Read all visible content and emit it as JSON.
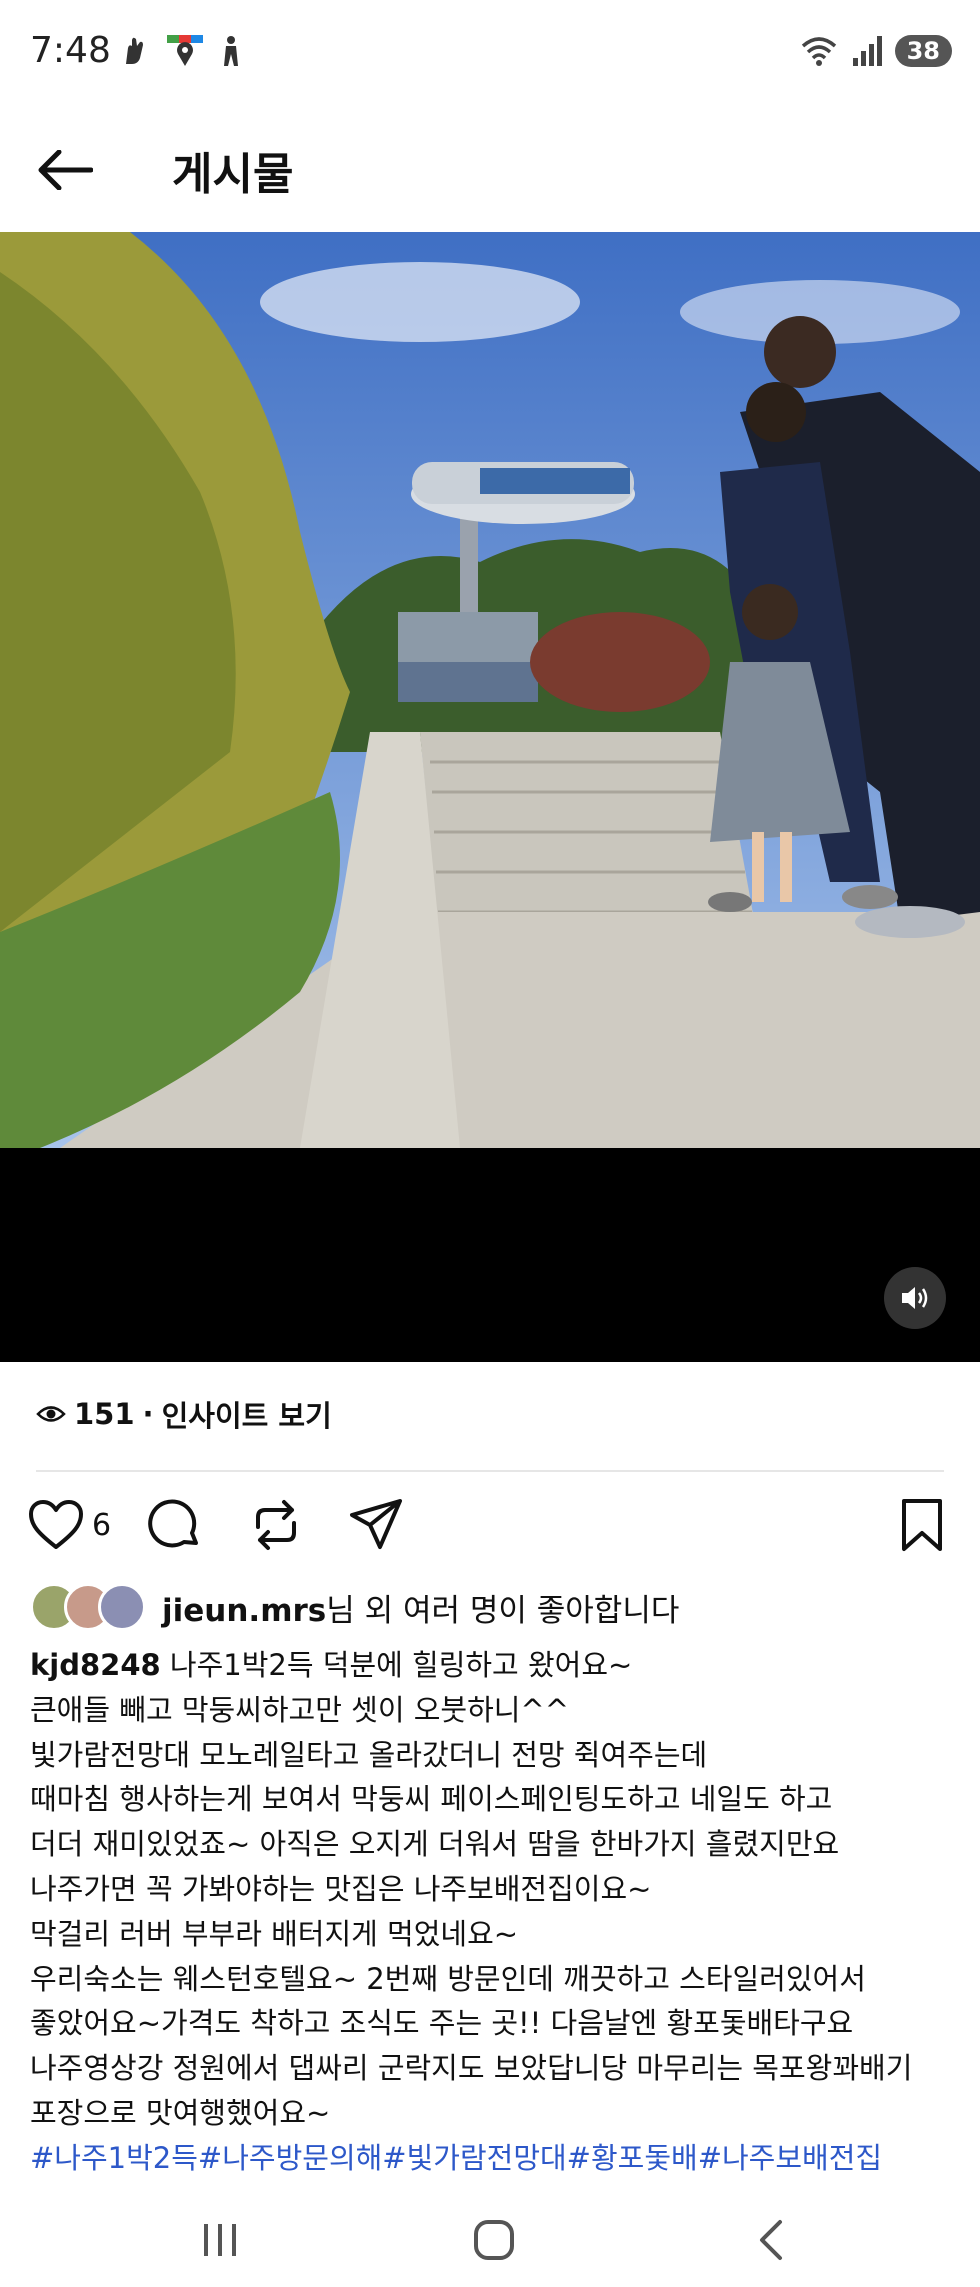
{
  "status_bar": {
    "time": "7:48",
    "battery": "38",
    "left_icons": [
      "hand-icon",
      "maps-pin-icon",
      "person-icon"
    ],
    "right_icons": [
      "wifi-icon",
      "signal-icon",
      "battery-icon"
    ]
  },
  "header": {
    "back_icon": "arrow-left-icon",
    "title": "게시물"
  },
  "media": {
    "sound_icon": "speaker-icon"
  },
  "insights": {
    "views": "151",
    "separator": "·",
    "label": "인사이트 보기"
  },
  "actions": {
    "like_count": "6",
    "icons": [
      "heart-icon",
      "comment-icon",
      "repost-icon",
      "share-icon",
      "bookmark-icon"
    ]
  },
  "likes": {
    "user": "jieun.mrs",
    "text": "님 외 여러 명이 좋아합니다"
  },
  "caption": {
    "username": "kjd8248",
    "first_line": " 나주1박2득 덕분에 힐링하고 왔어요~",
    "lines": [
      "큰애들 빼고 막둥씨하고만 셋이 오붓하니^^",
      "빛가람전망대 모노레일타고 올라갔더니 전망 쥑여주는데",
      "때마침 행사하는게 보여서 막둥씨 페이스페인팅도하고 네일도 하고",
      "더더 재미있었죠~ 아직은 오지게 더워서 땀을 한바가지 흘렸지만요",
      "나주가면 꼭 가봐야하는 맛집은 나주보배전집이요~",
      "막걸리 러버 부부라 배터지게 먹었네요~",
      "우리숙소는 웨스턴호텔요~ 2번째 방문인데 깨끗하고 스타일러있어서",
      "좋았어요~가격도 착하고 조식도 주는 곳!! 다음날엔 황포돛배타구요",
      "나주영상강 정원에서 댑싸리 군락지도 보았답니당 마무리는 목포왕꽈배기",
      "포장으로 맛여행했어요~"
    ],
    "hashtags": "#나주1박2득#나주방문의해#빛가람전망대#황포돛배#나주보배전집"
  },
  "navbar": {
    "icons": [
      "recent-apps-icon",
      "home-icon",
      "back-icon"
    ]
  }
}
